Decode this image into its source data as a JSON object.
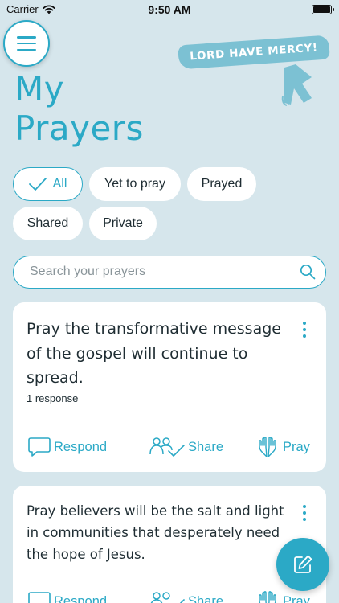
{
  "status_bar": {
    "carrier": "Carrier",
    "time": "9:50 AM",
    "battery_level": 1.0
  },
  "header": {
    "menu_icon": "hamburger-icon",
    "title_line1": "My",
    "title_line2": "Prayers",
    "logo_text": "LORD HAVE MERCY!"
  },
  "filters": {
    "all": "All",
    "yet_to_pray": "Yet to pray",
    "prayed": "Prayed",
    "shared": "Shared",
    "private": "Private",
    "active": "All"
  },
  "search": {
    "placeholder": "Search your prayers",
    "value": ""
  },
  "prayers": [
    {
      "text": "Pray the transformative message of the gospel will continue to spread.",
      "responses": "1 response",
      "actions": {
        "respond": "Respond",
        "share": "Share",
        "pray": "Pray"
      }
    },
    {
      "text": "Pray believers will be the salt and light in communities that desperately need the hope of Jesus.",
      "actions": {
        "respond": "Respond",
        "share": "Share",
        "pray": "Pray"
      }
    }
  ],
  "colors": {
    "accent": "#2ba9c6",
    "background": "#d6e6ec",
    "card": "#ffffff",
    "logo": "#7cc1d3"
  },
  "fab": {
    "icon": "compose-icon"
  }
}
